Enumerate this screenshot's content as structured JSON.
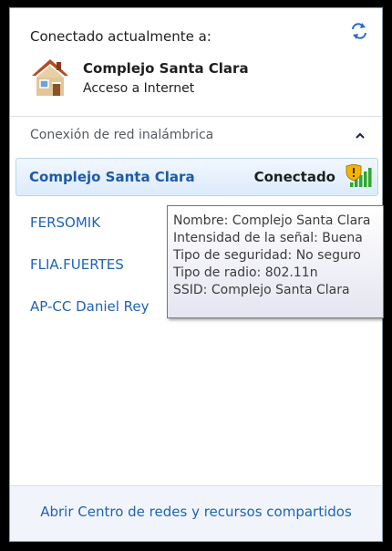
{
  "header": {
    "title": "Conectado actualmente a:",
    "network_name": "Complejo Santa Clara",
    "network_access": "Acceso a Internet"
  },
  "section": {
    "label": "Conexión de red inalámbrica"
  },
  "active_network": {
    "name": "Complejo Santa Clara",
    "status": "Conectado"
  },
  "networks": [
    {
      "name": "FERSOMIK"
    },
    {
      "name": "FLIA.FUERTES"
    },
    {
      "name": "AP-CC Daniel Rey"
    }
  ],
  "tooltip": {
    "lines": [
      "Nombre: Complejo Santa Clara",
      "Intensidad de la señal: Buena",
      "Tipo de seguridad: No seguro",
      "Tipo de radio: 802.11n",
      "SSID: Complejo Santa Clara"
    ]
  },
  "footer": {
    "link": "Abrir Centro de redes y recursos compartidos"
  },
  "colors": {
    "link_blue": "#1e63b4",
    "selection_top": "#f1f7fe",
    "selection_bottom": "#dcebfc",
    "signal_green": "#2fa82f",
    "shield_yellow": "#f2b400"
  },
  "icons": {
    "refresh": "refresh-icon",
    "house": "house-icon",
    "collapse": "chevron-up-icon",
    "signal": "signal-strength-icon",
    "shield": "security-warning-icon"
  }
}
